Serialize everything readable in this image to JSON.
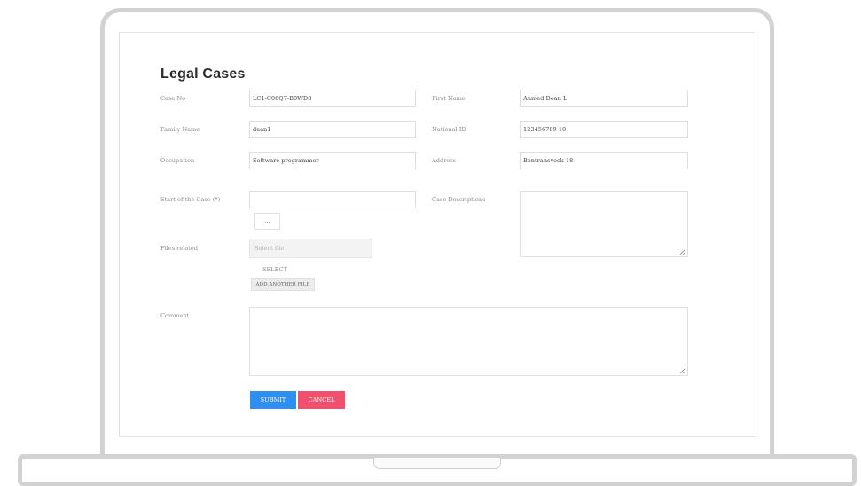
{
  "form": {
    "title": "Legal Cases",
    "fields": {
      "case_no": {
        "label": "Case No",
        "value": "LC1-C06Q7-B0WD8"
      },
      "first_name": {
        "label": "First Name",
        "value": "Ahmed Dean L"
      },
      "family_name": {
        "label": "Family Name",
        "value": "dean1"
      },
      "national_id": {
        "label": "National ID",
        "value": "123456789 10"
      },
      "occupation": {
        "label": "Occupation",
        "value": "Software programmer"
      },
      "address": {
        "label": "Address",
        "value": "Bentransvock 18"
      },
      "start_of_case": {
        "label": "Start of the Case (*)",
        "value": "",
        "picker_label": "..."
      },
      "case_description": {
        "label": "Case Descriptions",
        "value": ""
      },
      "files_related": {
        "label": "Files related",
        "placeholder": "Select file",
        "select_label": "SELECT",
        "add_button": "ADD ANOTHER FILE"
      },
      "comment": {
        "label": "Comment",
        "value": ""
      }
    },
    "buttons": {
      "submit": "SUBMIT",
      "cancel": "CANCEL"
    }
  },
  "colors": {
    "submit": "#2f8ff0",
    "cancel": "#f0506e",
    "frame": "#d2d2d2"
  }
}
